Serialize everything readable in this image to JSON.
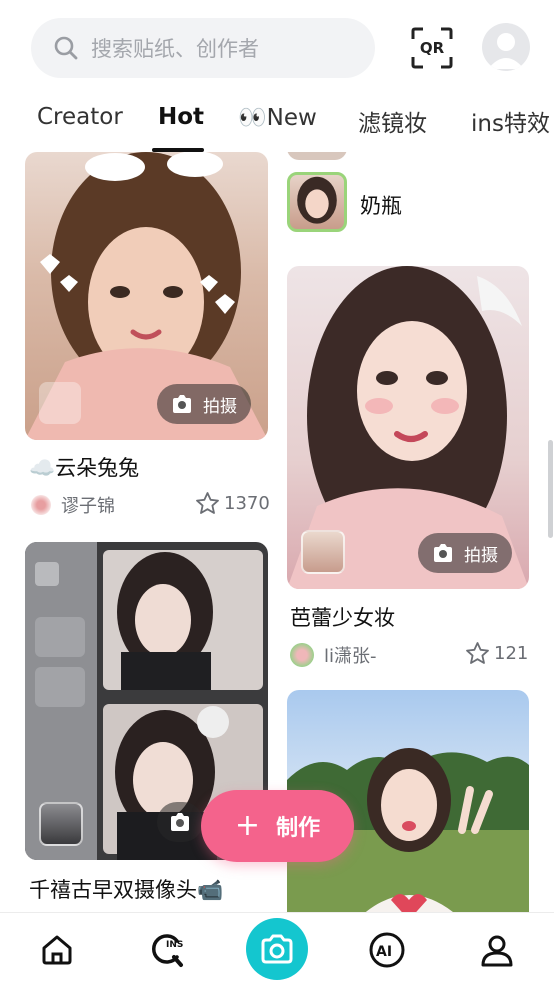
{
  "search": {
    "placeholder": "搜索贴纸、创作者"
  },
  "qr_label": "QR",
  "tabs": [
    "Creator",
    "Hot",
    "👀New",
    "滤镜妆",
    "ins特效"
  ],
  "cards": [
    {
      "title": "☁️云朵兔兔",
      "author": "谬子锦",
      "likes": "1370",
      "action": "拍摄"
    },
    {
      "title": "奶瓶"
    },
    {
      "title": "芭蕾少女妆",
      "author": "li潇张-",
      "likes": "121",
      "action": "拍摄"
    },
    {
      "title": "千禧古早双摄像头📹"
    }
  ],
  "make_button": {
    "plus": "+",
    "label": "制作"
  },
  "bottom_nav": [
    "home-icon",
    "ins-search-icon",
    "camera-icon",
    "ai-icon",
    "profile-icon"
  ],
  "colors": {
    "accent_pink": "#f4638c",
    "camera_teal": "#14c6cf"
  }
}
